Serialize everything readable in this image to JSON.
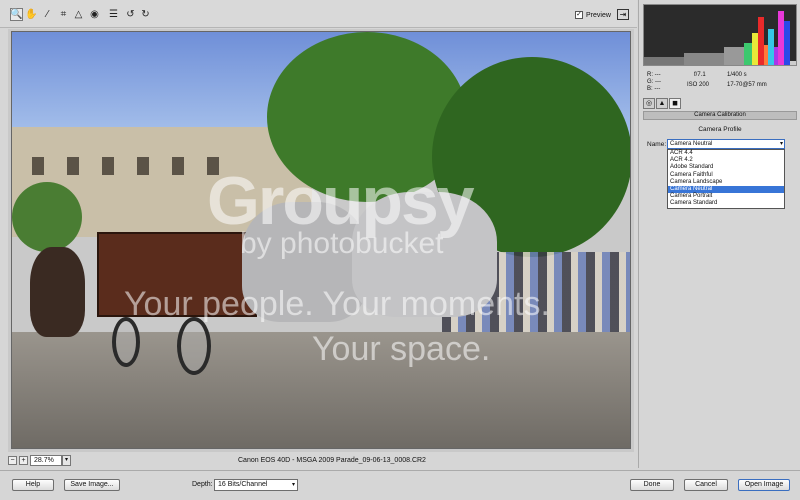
{
  "toolbar": {
    "tools": [
      {
        "name": "zoom-tool-icon",
        "glyph": "🔍",
        "active": true
      },
      {
        "name": "hand-tool-icon",
        "glyph": "✋",
        "active": false
      },
      {
        "name": "eyedropper-tool-icon",
        "glyph": "⁄",
        "active": false
      },
      {
        "name": "crop-tool-icon",
        "glyph": "⌗",
        "active": false
      },
      {
        "name": "straighten-tool-icon",
        "glyph": "△",
        "active": false
      },
      {
        "name": "redeye-tool-icon",
        "glyph": "◉",
        "active": false
      },
      {
        "name": "preferences-icon",
        "glyph": "☰",
        "active": false
      },
      {
        "name": "rotate-left-icon",
        "glyph": "↺",
        "active": false
      },
      {
        "name": "rotate-right-icon",
        "glyph": "↻",
        "active": false
      }
    ],
    "preview_label": "Preview",
    "preview_checked": "✓",
    "fullscreen_glyph": "⇥"
  },
  "watermark": {
    "line1": "Groupsy",
    "line2": "by photobucket",
    "line3": "Your people. Your moments.",
    "line4": "Your space."
  },
  "statusbar": {
    "zoom_out": "−",
    "zoom_in": "+",
    "zoom_value": "28.7%",
    "zoom_dropdown": "▾",
    "caption": "Canon EOS 40D  -  MSGA 2009 Parade_09-06-13_0008.CR2"
  },
  "info": {
    "r_label": "R:",
    "r_value": "---",
    "g_label": "G:",
    "g_value": "---",
    "b_label": "B:",
    "b_value": "---",
    "aperture": "f/7.1",
    "shutter": "1/400 s",
    "iso": "ISO 200",
    "lens": "17-70@57 mm"
  },
  "panel": {
    "tabs": [
      "◎",
      "▲",
      "◼"
    ],
    "section_title": "Camera Calibration",
    "profile_heading": "Camera Profile",
    "name_label": "Name:",
    "selected_profile": "Camera Neutral",
    "select_arrow": "▾",
    "options": [
      "ACR 4.4",
      "ACR 4.2",
      "Adobe Standard",
      "Camera Faithful",
      "Camera Landscape",
      "Camera Neutral",
      "Camera Portrait",
      "Camera Standard"
    ],
    "selected_index": 5
  },
  "bottom": {
    "help": "Help",
    "save_image": "Save Image...",
    "depth_label": "Depth:",
    "depth_value": "16 Bits/Channel",
    "depth_arrow": "▾",
    "done": "Done",
    "cancel": "Cancel",
    "open_image": "Open Image"
  },
  "colors": {
    "accent": "#3875d7",
    "histogram_bg": "#2b2b2b"
  }
}
